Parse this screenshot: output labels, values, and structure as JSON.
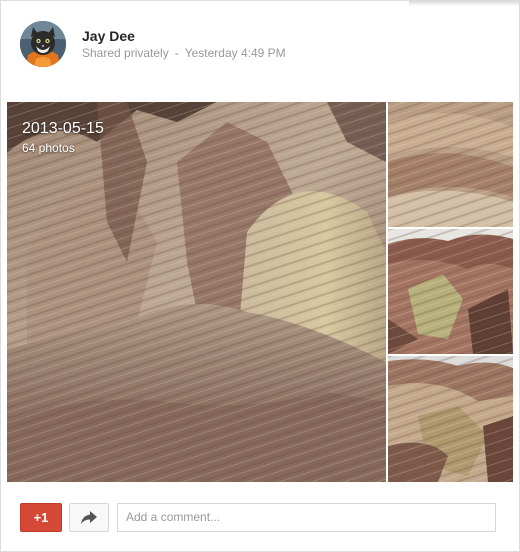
{
  "post": {
    "author": "Jay Dee",
    "visibility": "Shared privately",
    "separator": "-",
    "timestamp": "Yesterday 4:49 PM"
  },
  "album": {
    "date": "2013-05-15",
    "count": "64 photos"
  },
  "actions": {
    "plus_one": "+1",
    "share_icon": "share-arrow-icon",
    "comment_placeholder": "Add a comment..."
  },
  "colors": {
    "plus_one": "#d64937",
    "meta_text": "#999999"
  }
}
